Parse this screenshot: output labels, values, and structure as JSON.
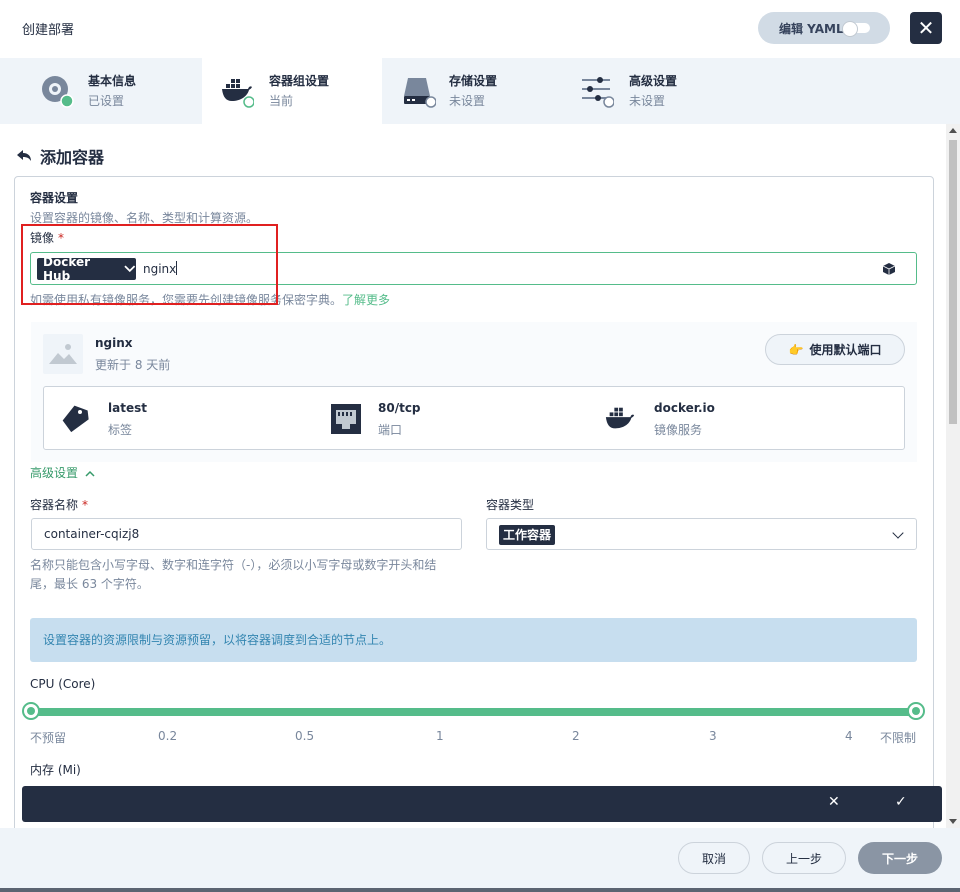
{
  "header": {
    "title": "创建部署",
    "yaml_label": "编辑 YAML",
    "close": "✕"
  },
  "steps": [
    {
      "title": "基本信息",
      "status": "已设置"
    },
    {
      "title": "容器组设置",
      "status": "当前"
    },
    {
      "title": "存储设置",
      "status": "未设置"
    },
    {
      "title": "高级设置",
      "status": "未设置"
    }
  ],
  "back_title": "添加容器",
  "container_settings": {
    "title": "容器设置",
    "description": "设置容器的镜像、名称、类型和计算资源。",
    "image_label": "镜像",
    "required_mark": "*",
    "registry": "Docker Hub",
    "image_value": "nginx",
    "hint": "如需使用私有镜像服务，您需要先创建镜像服务保密字典。",
    "learn_more": "了解更多"
  },
  "image_card": {
    "name": "nginx",
    "updated": "更新于 8 天前",
    "port_button": "使用默认端口",
    "info": [
      {
        "value": "latest",
        "key": "标签",
        "icon": "tag-icon"
      },
      {
        "value": "80/tcp",
        "key": "端口",
        "icon": "port-icon"
      },
      {
        "value": "docker.io",
        "key": "镜像服务",
        "icon": "docker-icon"
      }
    ]
  },
  "advanced_toggle": "高级设置",
  "container_name": {
    "label": "容器名称",
    "required_mark": "*",
    "value": "container-cqizj8",
    "help": "名称只能包含小写字母、数字和连字符（-），必须以小写字母或数字开头和结尾，最长 63 个字符。"
  },
  "container_type": {
    "label": "容器类型",
    "value": "工作容器"
  },
  "resource_banner": "设置容器的资源限制与资源预留，以将容器调度到合适的节点上。",
  "cpu": {
    "label": "CPU (Core)",
    "ticks": [
      "不预留",
      "0.2",
      "0.5",
      "1",
      "2",
      "3",
      "4",
      "不限制"
    ],
    "range_min_fraction": 0,
    "range_max_fraction": 1
  },
  "memory": {
    "label": "内存 (Mi)"
  },
  "notification": {
    "close": "✕",
    "confirm": "✓"
  },
  "footer": {
    "cancel": "取消",
    "prev": "上一步",
    "next": "下一步"
  },
  "colors": {
    "accent": "#55bc8a",
    "dark": "#242e42",
    "banner": "#c7deef",
    "highlight": "#e02020"
  }
}
